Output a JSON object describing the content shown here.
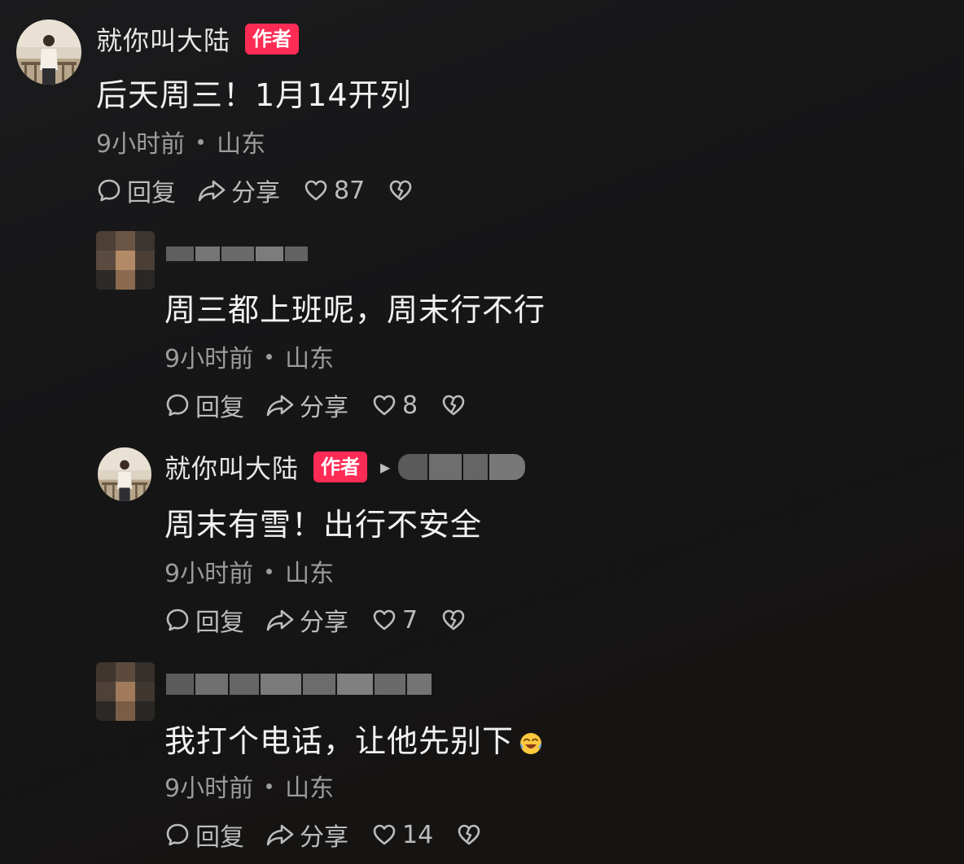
{
  "comments": [
    {
      "username": "就你叫大陆",
      "author_badge": "作者",
      "text": "后天周三！1月14开列",
      "time": "9小时前",
      "location": "山东",
      "reply_label": "回复",
      "share_label": "分享",
      "likes": "87"
    },
    {
      "text": "周三都上班呢，周末行不行",
      "time": "9小时前",
      "location": "山东",
      "reply_label": "回复",
      "share_label": "分享",
      "likes": "8"
    },
    {
      "username": "就你叫大陆",
      "author_badge": "作者",
      "text": "周末有雪！出行不安全",
      "time": "9小时前",
      "location": "山东",
      "reply_label": "回复",
      "share_label": "分享",
      "likes": "7"
    },
    {
      "text": "我打个电话，让他先别下",
      "time": "9小时前",
      "location": "山东",
      "reply_label": "回复",
      "share_label": "分享",
      "likes": "14"
    }
  ],
  "colors": {
    "background": "#161616",
    "author_badge": "#fe2c55",
    "meta_text": "#9c9c9c"
  },
  "icons": {
    "reply": "speech-bubble-icon",
    "share": "share-arrow-icon",
    "like": "heart-icon",
    "dislike": "broken-heart-icon",
    "emoji": "laughing-crying-emoji"
  }
}
